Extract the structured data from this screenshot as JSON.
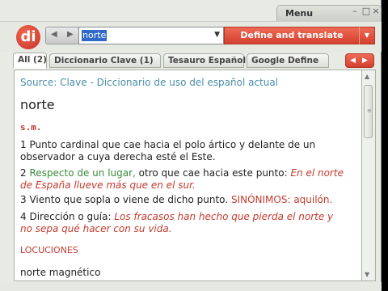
{
  "window": {
    "menu_label": "Menu",
    "minimize": "–",
    "maximize": "□",
    "close": "×"
  },
  "toolbar": {
    "logo_text": "di",
    "back": "◀",
    "forward": "▶",
    "search_value": "norte",
    "search_dropdown": "▼",
    "define_label": "Define and translate",
    "define_dropdown": "▼"
  },
  "tabs": [
    {
      "label": "All (2)",
      "active": true
    },
    {
      "label": "Diccionario Clave (1)",
      "active": false
    },
    {
      "label": "Tesauro Español (1)",
      "active": false
    },
    {
      "label": "Google Define",
      "active": false
    }
  ],
  "tab_nav": {
    "prev": "◀",
    "next": "▶"
  },
  "entry": {
    "source_prefix": "Source:",
    "source_name": "Clave - Diccionario de uso del español actual",
    "headword": "norte",
    "pos": "s.m.",
    "defs": [
      {
        "num": "1",
        "text": "Punto cardinal que cae hacia el polo ártico y delante de un observador a cuya derecha esté el Este."
      },
      {
        "num": "2",
        "label": "Respecto de un lugar,",
        "text": " otro que cae hacia este punto:",
        "example": " En el norte de España llueve más que en el sur."
      },
      {
        "num": "3",
        "text": "Viento que sopla o viene de dicho punto.",
        "syn_label": " SINÓNIMOS:",
        "syn_word": " aquilón."
      },
      {
        "num": "4",
        "text": "Dirección o guía:",
        "example": " Los fracasos han hecho que pierda el norte y no sepa qué hacer con su vida."
      }
    ],
    "locuciones": "LOCUCIONES",
    "next_item": "norte magnético"
  },
  "scrollbar": {
    "up": "▲",
    "down": "▼",
    "grip": "≡"
  },
  "colors": {
    "accent": "#d4412f",
    "source": "#4a8fa6",
    "label_green": "#3a8a3a",
    "example_red": "#c43a2e"
  }
}
